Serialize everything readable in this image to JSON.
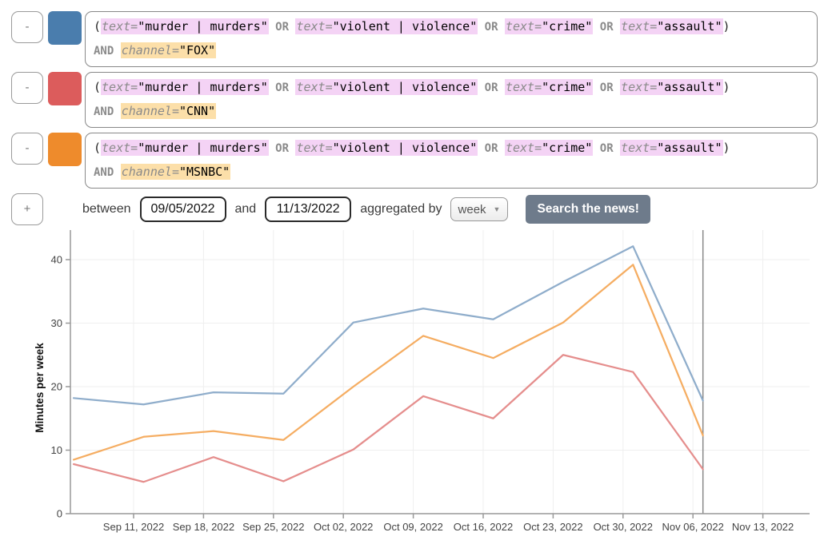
{
  "query_syntax": {
    "or": "OR",
    "and": "AND",
    "eq": "=",
    "open": "(",
    "close": ")",
    "remove_label": "-"
  },
  "queries": [
    {
      "color": "#4a7dad",
      "clauses": [
        {
          "field": "text",
          "value": "\"murder | murders\""
        },
        {
          "field": "text",
          "value": "\"violent | violence\""
        },
        {
          "field": "text",
          "value": "\"crime\""
        },
        {
          "field": "text",
          "value": "\"assault\""
        }
      ],
      "channel": {
        "field": "channel",
        "value": "\"FOX\""
      }
    },
    {
      "color": "#dc5c5c",
      "clauses": [
        {
          "field": "text",
          "value": "\"murder | murders\""
        },
        {
          "field": "text",
          "value": "\"violent | violence\""
        },
        {
          "field": "text",
          "value": "\"crime\""
        },
        {
          "field": "text",
          "value": "\"assault\""
        }
      ],
      "channel": {
        "field": "channel",
        "value": "\"CNN\""
      }
    },
    {
      "color": "#ee8b2c",
      "clauses": [
        {
          "field": "text",
          "value": "\"murder | murders\""
        },
        {
          "field": "text",
          "value": "\"violent | violence\""
        },
        {
          "field": "text",
          "value": "\"crime\""
        },
        {
          "field": "text",
          "value": "\"assault\""
        }
      ],
      "channel": {
        "field": "channel",
        "value": "\"MSNBC\""
      }
    }
  ],
  "controls": {
    "add_label": "+",
    "between_label": "between",
    "start_date": "09/05/2022",
    "and_label": "and",
    "end_date": "11/13/2022",
    "aggregated_by_label": "aggregated by",
    "aggregate_value": "week",
    "dropdown_arrow": "▼",
    "search_label": "Search the news!",
    "search_bg": "#6e7b8b"
  },
  "chart_data": {
    "type": "line",
    "ylabel": "Minutes per week",
    "xlabel": "",
    "yticks": [
      0,
      10,
      20,
      30,
      40
    ],
    "ylim": [
      0,
      45
    ],
    "grid": true,
    "legend": "none",
    "tick_labels": [
      "Sep 11, 2022",
      "Sep 18, 2022",
      "Sep 25, 2022",
      "Oct 02, 2022",
      "Oct 09, 2022",
      "Oct 16, 2022",
      "Oct 23, 2022",
      "Oct 30, 2022",
      "Nov 06, 2022",
      "Nov 13, 2022"
    ],
    "point_dates": [
      "09/05/2022",
      "09/12/2022",
      "09/19/2022",
      "09/26/2022",
      "10/03/2022",
      "10/10/2022",
      "10/17/2022",
      "10/24/2022",
      "10/31/2022",
      "11/07/2022"
    ],
    "series": [
      {
        "name": "FOX",
        "line_color": "#8fadcb",
        "values": [
          18.2,
          17.2,
          19.1,
          18.9,
          30.1,
          32.3,
          30.6,
          36.5,
          42.1,
          17.8
        ]
      },
      {
        "name": "CNN",
        "line_color": "#e58e8d",
        "values": [
          7.8,
          5.0,
          8.9,
          5.1,
          10.1,
          18.5,
          15.0,
          25.0,
          22.3,
          7.0
        ]
      },
      {
        "name": "MSNBC",
        "line_color": "#f5ad62",
        "values": [
          8.5,
          12.1,
          13.0,
          11.6,
          20.0,
          28.0,
          24.5,
          30.1,
          39.2,
          12.3
        ]
      }
    ],
    "marker_line_at_last_point": true,
    "axis_color": "#999999",
    "grid_color": "#efefef",
    "marker_color": "#888888",
    "tick_text_color": "#444444"
  }
}
